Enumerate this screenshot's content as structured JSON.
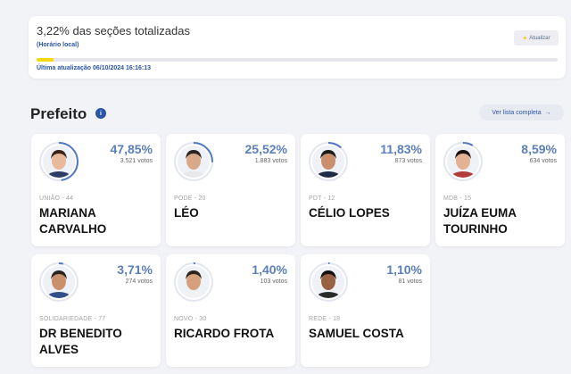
{
  "status": {
    "title": "3,22% das seções totalizadas",
    "subtitle": "(Horário local)",
    "update_button": "Atualizar",
    "last_update": "Última atualização 06/10/2024 16:16:13",
    "progress_percent": 3.22
  },
  "section": {
    "title": "Prefeito",
    "info_icon": "i",
    "full_list_button": "Ver lista completa",
    "arrow": "→"
  },
  "candidates": [
    {
      "party": "UNIÃO - 44",
      "name": "MARIANA CARVALHO",
      "percent": "47,85%",
      "votes": "3.521 votos",
      "share": 0.4785
    },
    {
      "party": "PODE - 20",
      "name": "LÉO",
      "percent": "25,52%",
      "votes": "1.883 votos",
      "share": 0.2552
    },
    {
      "party": "PDT - 12",
      "name": "CÉLIO LOPES",
      "percent": "11,83%",
      "votes": "873 votos",
      "share": 0.1183
    },
    {
      "party": "MDB - 15",
      "name": "JUÍZA EUMA TOURINHO",
      "percent": "8,59%",
      "votes": "634 votos",
      "share": 0.0859
    },
    {
      "party": "SOLIDARIEDADE - 77",
      "name": "DR BENEDITO ALVES",
      "percent": "3,71%",
      "votes": "274 votos",
      "share": 0.0371
    },
    {
      "party": "NOVO - 30",
      "name": "RICARDO FROTA",
      "percent": "1,40%",
      "votes": "103 votos",
      "share": 0.014
    },
    {
      "party": "REDE - 18",
      "name": "SAMUEL COSTA",
      "percent": "1,10%",
      "votes": "81 votos",
      "share": 0.011
    }
  ],
  "colors": {
    "accent": "#2a55a6",
    "percent": "#5b7fb8",
    "progress": "#f5d90f",
    "ring": "#4f78c2"
  }
}
